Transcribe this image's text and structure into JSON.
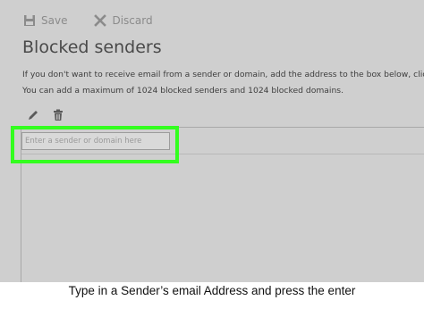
{
  "toolbar": {
    "save_label": "Save",
    "discard_label": "Discard",
    "save_icon": "floppy-disk-icon",
    "discard_icon": "close-x-icon"
  },
  "page": {
    "title": "Blocked senders",
    "description_line1": "If you don't want to receive email from a sender or domain, add the address to the box below, click t",
    "description_line2": "You can add a maximum of 1024 blocked senders and 1024 blocked domains."
  },
  "list_actions": {
    "edit_icon": "pencil-icon",
    "delete_icon": "trash-can-icon"
  },
  "sender_input": {
    "placeholder": "Enter a sender or domain here",
    "value": ""
  },
  "highlight_color": "#33ff1f",
  "caption": "Type in a Sender’s email Address and press the enter"
}
